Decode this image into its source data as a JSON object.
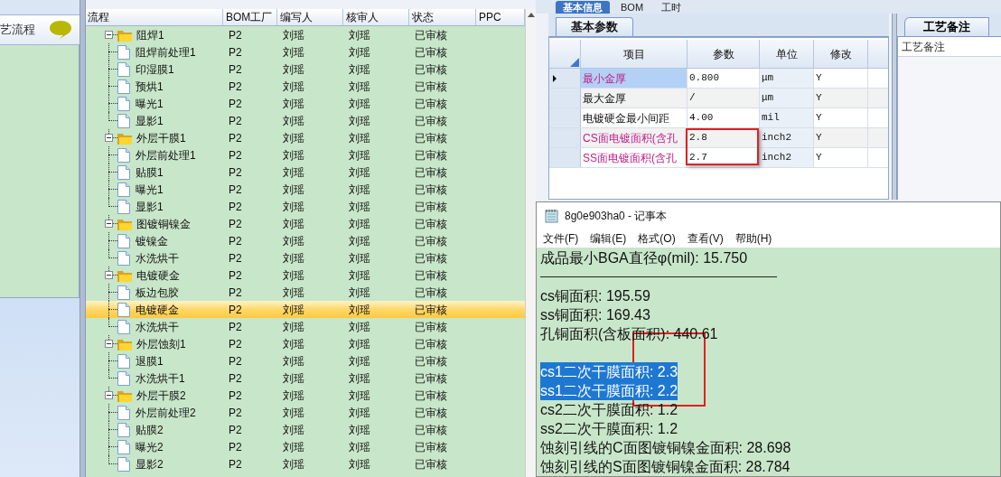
{
  "top_tabs": [
    {
      "label": "基本信息",
      "selected": true
    },
    {
      "label": "BOM",
      "selected": false
    },
    {
      "label": "工时",
      "selected": false
    }
  ],
  "left_panel": {
    "title": "艺流程"
  },
  "tree": {
    "columns": [
      "流程",
      "BOM工厂",
      "编写人",
      "核审人",
      "状态",
      "PPC"
    ],
    "nodes": [
      {
        "label": "阻焊1",
        "bom": "P2",
        "writer": "刘瑶",
        "reviewer": "刘瑶",
        "status": "已审核",
        "selected": false,
        "expanded": true,
        "children": [
          {
            "label": "阻焊前处理1",
            "bom": "P2",
            "writer": "刘瑶",
            "reviewer": "刘瑶",
            "status": "已审核",
            "selected": false
          },
          {
            "label": "印湿膜1",
            "bom": "P2",
            "writer": "刘瑶",
            "reviewer": "刘瑶",
            "status": "已审核",
            "selected": false
          },
          {
            "label": "预烘1",
            "bom": "P2",
            "writer": "刘瑶",
            "reviewer": "刘瑶",
            "status": "已审核",
            "selected": false
          },
          {
            "label": "曝光1",
            "bom": "P2",
            "writer": "刘瑶",
            "reviewer": "刘瑶",
            "status": "已审核",
            "selected": false
          },
          {
            "label": "显影1",
            "bom": "P2",
            "writer": "刘瑶",
            "reviewer": "刘瑶",
            "status": "已审核",
            "selected": false
          }
        ]
      },
      {
        "label": "外层干膜1",
        "bom": "P2",
        "writer": "刘瑶",
        "reviewer": "刘瑶",
        "status": "已审核",
        "selected": false,
        "expanded": true,
        "children": [
          {
            "label": "外层前处理1",
            "bom": "P2",
            "writer": "刘瑶",
            "reviewer": "刘瑶",
            "status": "已审核",
            "selected": false
          },
          {
            "label": "贴膜1",
            "bom": "P2",
            "writer": "刘瑶",
            "reviewer": "刘瑶",
            "status": "已审核",
            "selected": false
          },
          {
            "label": "曝光1",
            "bom": "P2",
            "writer": "刘瑶",
            "reviewer": "刘瑶",
            "status": "已审核",
            "selected": false
          },
          {
            "label": "显影1",
            "bom": "P2",
            "writer": "刘瑶",
            "reviewer": "刘瑶",
            "status": "已审核",
            "selected": false
          }
        ]
      },
      {
        "label": "图镀铜镍金",
        "bom": "P2",
        "writer": "刘瑶",
        "reviewer": "刘瑶",
        "status": "已审核",
        "selected": false,
        "expanded": true,
        "children": [
          {
            "label": "镀镍金",
            "bom": "P2",
            "writer": "刘瑶",
            "reviewer": "刘瑶",
            "status": "已审核",
            "selected": false
          },
          {
            "label": "水洗烘干",
            "bom": "P2",
            "writer": "刘瑶",
            "reviewer": "刘瑶",
            "status": "已审核",
            "selected": false
          }
        ]
      },
      {
        "label": "电镀硬金",
        "bom": "P2",
        "writer": "刘瑶",
        "reviewer": "刘瑶",
        "status": "已审核",
        "selected": false,
        "expanded": true,
        "children": [
          {
            "label": "板边包胶",
            "bom": "P2",
            "writer": "刘瑶",
            "reviewer": "刘瑶",
            "status": "已审核",
            "selected": false
          },
          {
            "label": "电镀硬金",
            "bom": "P2",
            "writer": "刘瑶",
            "reviewer": "刘瑶",
            "status": "已审核",
            "selected": true
          },
          {
            "label": "水洗烘干",
            "bom": "P2",
            "writer": "刘瑶",
            "reviewer": "刘瑶",
            "status": "已审核",
            "selected": false
          }
        ]
      },
      {
        "label": "外层蚀刻1",
        "bom": "P2",
        "writer": "刘瑶",
        "reviewer": "刘瑶",
        "status": "已审核",
        "selected": false,
        "expanded": true,
        "children": [
          {
            "label": "退膜1",
            "bom": "P2",
            "writer": "刘瑶",
            "reviewer": "刘瑶",
            "status": "已审核",
            "selected": false
          },
          {
            "label": "水洗烘干1",
            "bom": "P2",
            "writer": "刘瑶",
            "reviewer": "刘瑶",
            "status": "已审核",
            "selected": false
          }
        ]
      },
      {
        "label": "外层干膜2",
        "bom": "P2",
        "writer": "刘瑶",
        "reviewer": "刘瑶",
        "status": "已审核",
        "selected": false,
        "expanded": true,
        "children": [
          {
            "label": "外层前处理2",
            "bom": "P2",
            "writer": "刘瑶",
            "reviewer": "刘瑶",
            "status": "已审核",
            "selected": false
          },
          {
            "label": "贴膜2",
            "bom": "P2",
            "writer": "刘瑶",
            "reviewer": "刘瑶",
            "status": "已审核",
            "selected": false
          },
          {
            "label": "曝光2",
            "bom": "P2",
            "writer": "刘瑶",
            "reviewer": "刘瑶",
            "status": "已审核",
            "selected": false
          },
          {
            "label": "显影2",
            "bom": "P2",
            "writer": "刘瑶",
            "reviewer": "刘瑶",
            "status": "已审核",
            "selected": false
          }
        ]
      }
    ]
  },
  "params": {
    "tab": "基本参数",
    "columns": [
      "项目",
      "参数",
      "单位",
      "修改"
    ],
    "rows": [
      {
        "item": "最小金厚",
        "value": "0.800",
        "unit": "μm",
        "modify": "Y",
        "flagged": true,
        "selected": true
      },
      {
        "item": "最大金厚",
        "value": "/",
        "unit": "μm",
        "modify": "Y",
        "flagged": false,
        "selected": false
      },
      {
        "item": "电镀硬金最小间距",
        "value": "4.00",
        "unit": "mil",
        "modify": "Y",
        "flagged": false,
        "selected": false
      },
      {
        "item": "CS面电镀面积(含孔",
        "value": "2.8",
        "unit": "inch2",
        "modify": "Y",
        "flagged": true,
        "selected": false
      },
      {
        "item": "SS面电镀面积(含孔",
        "value": "2.7",
        "unit": "inch2",
        "modify": "Y",
        "flagged": true,
        "selected": false
      }
    ]
  },
  "notes_panel": {
    "tab": "工艺备注",
    "label": "工艺备注"
  },
  "notepad": {
    "title": "8g0e903ha0 - 记事本",
    "menu": [
      "文件(F)",
      "编辑(E)",
      "格式(O)",
      "查看(V)",
      "帮助(H)"
    ],
    "lines": [
      {
        "kind": "text",
        "text": "成品最小BGA直径φ(mil):  15.750",
        "selected": false
      },
      {
        "kind": "rule"
      },
      {
        "kind": "text",
        "text": "cs铜面积: 195.59",
        "selected": false
      },
      {
        "kind": "text",
        "text": "ss铜面积: 169.43",
        "selected": false
      },
      {
        "kind": "text",
        "text": "孔铜面积(含板面积): 440.61",
        "selected": false
      },
      {
        "kind": "blank"
      },
      {
        "kind": "text",
        "text": "cs1二次干膜面积: 2.3",
        "selected": true
      },
      {
        "kind": "text",
        "text": "ss1二次干膜面积: 2.2",
        "selected": true
      },
      {
        "kind": "text",
        "text": "cs2二次干膜面积: 1.2",
        "selected": false
      },
      {
        "kind": "text",
        "text": "ss2二次干膜面积: 1.2",
        "selected": false
      },
      {
        "kind": "text",
        "text": "蚀刻引线的C面图镀铜镍金面积: 28.698",
        "selected": false
      },
      {
        "kind": "text",
        "text": "蚀刻引线的S面图镀铜镍金面积: 28.784",
        "selected": false
      }
    ]
  }
}
